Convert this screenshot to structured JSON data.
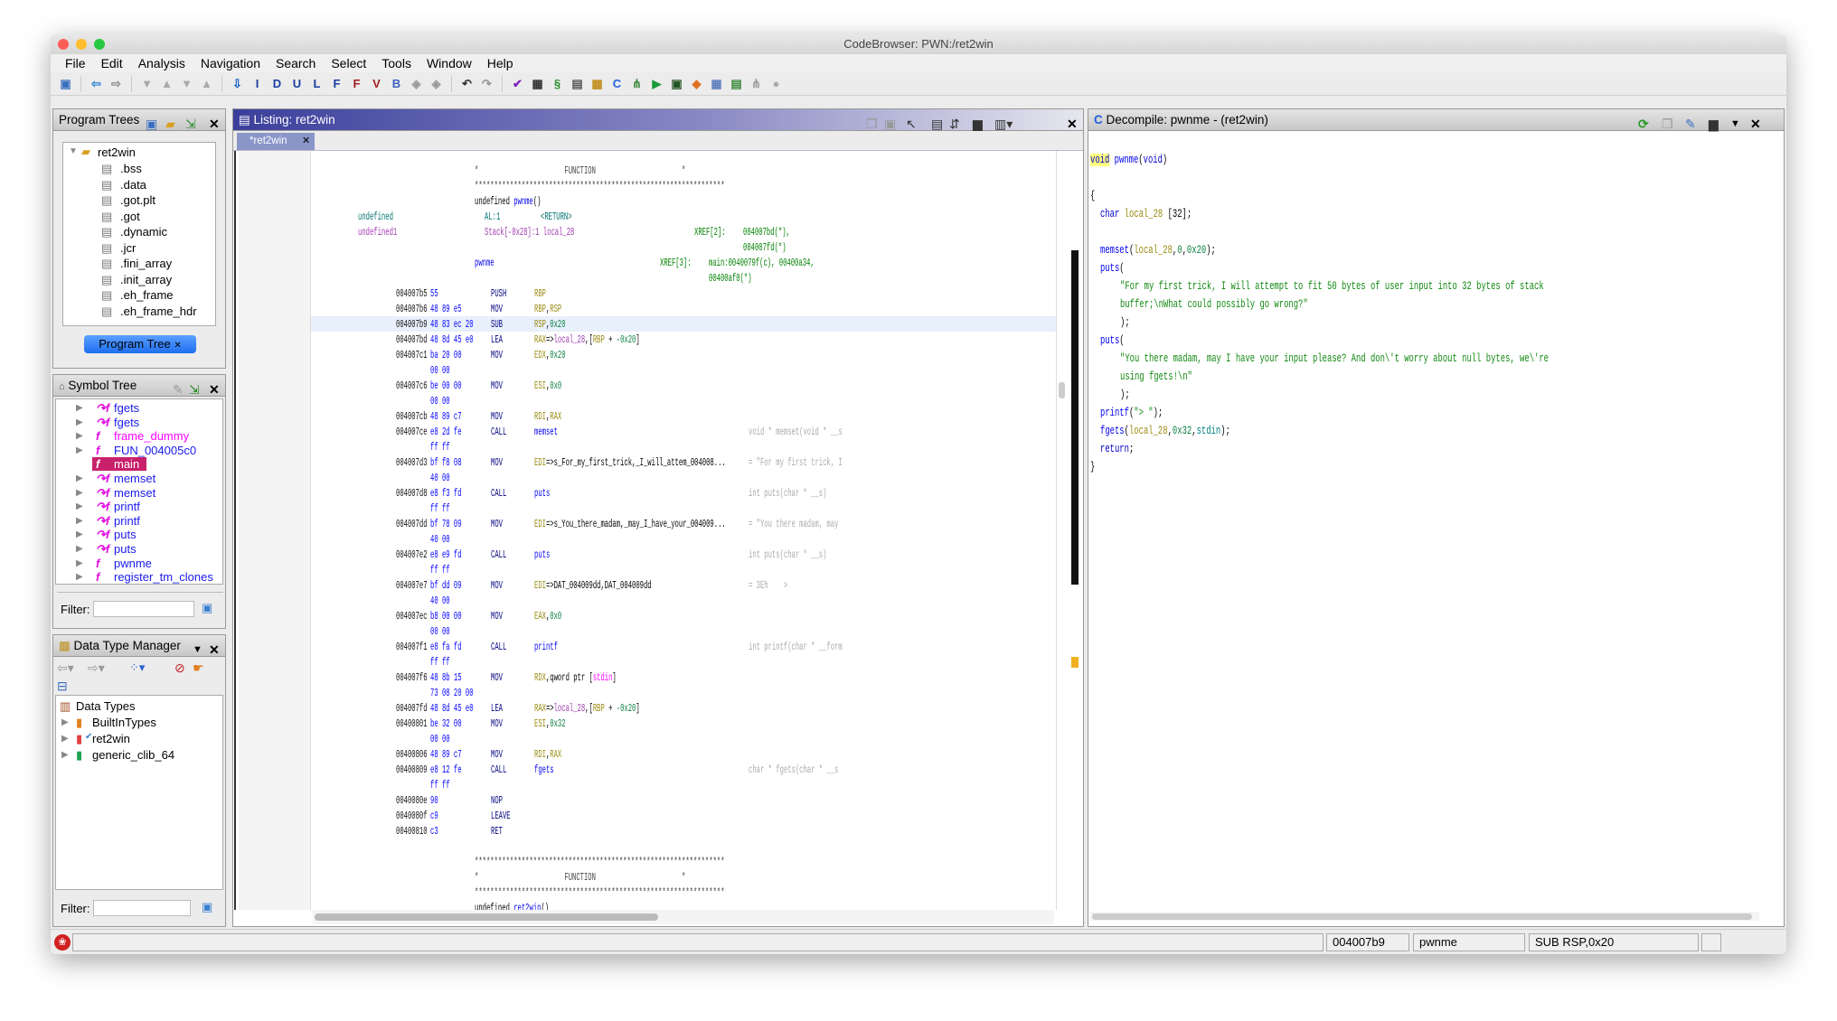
{
  "window": {
    "title": "CodeBrowser: PWN:/ret2win"
  },
  "menu": [
    "File",
    "Edit",
    "Analysis",
    "Navigation",
    "Search",
    "Select",
    "Tools",
    "Window",
    "Help"
  ],
  "toolbar": [
    {
      "icon": "save-icon",
      "g": "▣",
      "c": "#3a6fc0"
    },
    {
      "icon": "back-icon",
      "g": "⇦",
      "c": "#2a7fd0"
    },
    {
      "icon": "forward-icon",
      "g": "⇨",
      "c": "#888"
    },
    {
      "icon": "nav-1-icon",
      "g": "▼",
      "c": "#aaa"
    },
    {
      "icon": "nav-2-icon",
      "g": "▲",
      "c": "#aaa"
    },
    {
      "icon": "nav-3-icon",
      "g": "▼",
      "c": "#aaa"
    },
    {
      "icon": "nav-4-icon",
      "g": "▲",
      "c": "#aaa"
    },
    {
      "icon": "down-arrow-icon",
      "g": "⇩",
      "c": "#1a5fc0"
    },
    {
      "icon": "instruction-icon",
      "g": "I",
      "c": "#1a3fa0"
    },
    {
      "icon": "data-icon",
      "g": "D",
      "c": "#1a3fa0"
    },
    {
      "icon": "undefined-icon",
      "g": "U",
      "c": "#1a3fa0"
    },
    {
      "icon": "label-icon",
      "g": "L",
      "c": "#1a3fa0"
    },
    {
      "icon": "function-icon",
      "g": "F",
      "c": "#1a3fa0"
    },
    {
      "icon": "no-function-icon",
      "g": "F",
      "c": "#a02020"
    },
    {
      "icon": "variable-icon",
      "g": "V",
      "c": "#a02020"
    },
    {
      "icon": "bookmark-icon",
      "g": "B",
      "c": "#4060c0"
    },
    {
      "icon": "merge-1-icon",
      "g": "◈",
      "c": "#999"
    },
    {
      "icon": "merge-2-icon",
      "g": "◈",
      "c": "#999"
    },
    {
      "icon": "undo-icon",
      "g": "↶",
      "c": "#333"
    },
    {
      "icon": "redo-icon",
      "g": "↷",
      "c": "#999"
    },
    {
      "icon": "check-icon",
      "g": "✔",
      "c": "#8020c0"
    },
    {
      "icon": "bytes-icon",
      "g": "▦",
      "c": "#333"
    },
    {
      "icon": "script-icon",
      "g": "§",
      "c": "#2a8a2a"
    },
    {
      "icon": "memory-icon",
      "g": "▤",
      "c": "#555"
    },
    {
      "icon": "datatype-icon",
      "g": "▩",
      "c": "#c09020"
    },
    {
      "icon": "decompile-icon",
      "g": "C",
      "c": "#2060e0"
    },
    {
      "icon": "graph-icon",
      "g": "⋔",
      "c": "#3a8a3a"
    },
    {
      "icon": "run-icon",
      "g": "▶",
      "c": "#1a9a3a"
    },
    {
      "icon": "chip-icon",
      "g": "▣",
      "c": "#225522"
    },
    {
      "icon": "diamond-icon",
      "g": "◆",
      "c": "#e07020"
    },
    {
      "icon": "table-icon",
      "g": "▦",
      "c": "#6080c0"
    },
    {
      "icon": "export-icon",
      "g": "▤",
      "c": "#3a8a3a"
    },
    {
      "icon": "tree-icon",
      "g": "⋔",
      "c": "#999"
    },
    {
      "icon": "help-icon",
      "g": "●",
      "c": "#aaa"
    }
  ],
  "program_trees": {
    "title": "Program Trees",
    "root": "ret2win",
    "items": [
      ".bss",
      ".data",
      ".got.plt",
      ".got",
      ".dynamic",
      ".jcr",
      ".fini_array",
      ".init_array",
      ".eh_frame",
      ".eh_frame_hdr"
    ],
    "tab": "Program Tree"
  },
  "symbol_tree": {
    "title": "Symbol Tree",
    "items": [
      {
        "label": "fgets",
        "color": "#1a1aee",
        "thunk": true
      },
      {
        "label": "fgets",
        "color": "#1a1aee",
        "thunk": true
      },
      {
        "label": "frame_dummy",
        "color": "#ff00ff",
        "thunk": false
      },
      {
        "label": "FUN_004005c0",
        "color": "#1a1aee",
        "thunk": false
      },
      {
        "label": "main",
        "color": "#ffffff",
        "thunk": false,
        "selected": true
      },
      {
        "label": "memset",
        "color": "#1a1aee",
        "thunk": true
      },
      {
        "label": "memset",
        "color": "#1a1aee",
        "thunk": true
      },
      {
        "label": "printf",
        "color": "#1a1aee",
        "thunk": true
      },
      {
        "label": "printf",
        "color": "#1a1aee",
        "thunk": true
      },
      {
        "label": "puts",
        "color": "#1a1aee",
        "thunk": true
      },
      {
        "label": "puts",
        "color": "#1a1aee",
        "thunk": true
      },
      {
        "label": "pwnme",
        "color": "#1a1aee",
        "thunk": false
      },
      {
        "label": "register_tm_clones",
        "color": "#1a1aee",
        "thunk": false
      }
    ],
    "filter_label": "Filter:"
  },
  "data_type_manager": {
    "title": "Data Type Manager",
    "root": "Data Types",
    "items": [
      {
        "label": "BuiltInTypes",
        "color": "#e08020"
      },
      {
        "label": "ret2win",
        "color": "#e04040"
      },
      {
        "label": "generic_clib_64",
        "color": "#20a050"
      }
    ],
    "filter_label": "Filter:"
  },
  "listing": {
    "title": "Listing:  ret2win",
    "tab": "*ret2win",
    "lines": [
      {
        "h": "*                      FUNCTION                      *"
      },
      {
        "h": "****************************************************************"
      },
      {
        "sig": [
          "undefined ",
          "pwnme",
          "()"
        ]
      },
      {
        "p1": [
          "undefined",
          "AL:1",
          "<RETURN>"
        ],
        "pc": "#007070"
      },
      {
        "p1": [
          "undefined1",
          "Stack[-0x28]:1 local_28",
          ""
        ],
        "pc": "#a03cb0",
        "xref": "XREF[2]:",
        "xv": "004007bd(*),"
      },
      {
        "xv": "004007fd(*)"
      },
      {
        "label": "pwnme",
        "xref3": "XREF[3]:",
        "xv3": "main:0040079f(c), 00400a34,"
      },
      {
        "xv3": "00400af0(*)"
      },
      {
        "a": "004007b5",
        "b": "55",
        "m": "PUSH",
        "o": [
          [
            "reg",
            "RBP"
          ]
        ]
      },
      {
        "a": "004007b6",
        "b": "48 89 e5",
        "m": "MOV",
        "o": [
          [
            "reg",
            "RBP"
          ],
          [
            "txt",
            ","
          ],
          [
            "reg",
            "RSP"
          ]
        ]
      },
      {
        "a": "004007b9",
        "b": "48 83 ec 20",
        "m": "SUB",
        "o": [
          [
            "reg",
            "RSP"
          ],
          [
            "txt",
            ","
          ],
          [
            "num",
            "0x20"
          ]
        ],
        "sel": true
      },
      {
        "a": "004007bd",
        "b": "48 8d 45 e0",
        "m": "LEA",
        "o": [
          [
            "reg",
            "RAX"
          ],
          [
            "txt",
            "=>"
          ],
          [
            "var",
            "local_28"
          ],
          [
            "txt",
            ",["
          ],
          [
            "reg",
            "RBP"
          ],
          [
            "txt",
            " + "
          ],
          [
            "num",
            "-0x20"
          ],
          [
            "txt",
            "]"
          ]
        ]
      },
      {
        "a": "004007c1",
        "b": "ba 20 00",
        "m": "MOV",
        "o": [
          [
            "reg",
            "EDX"
          ],
          [
            "txt",
            ","
          ],
          [
            "num",
            "0x20"
          ]
        ]
      },
      {
        "b": "00 00"
      },
      {
        "a": "004007c6",
        "b": "be 00 00",
        "m": "MOV",
        "o": [
          [
            "reg",
            "ESI"
          ],
          [
            "txt",
            ","
          ],
          [
            "num",
            "0x0"
          ]
        ]
      },
      {
        "b": "00 00"
      },
      {
        "a": "004007cb",
        "b": "48 89 c7",
        "m": "MOV",
        "o": [
          [
            "reg",
            "RDI"
          ],
          [
            "txt",
            ","
          ],
          [
            "reg",
            "RAX"
          ]
        ]
      },
      {
        "a": "004007ce",
        "b": "e8 2d fe",
        "m": "CALL",
        "o": [
          [
            "fn",
            "memset"
          ]
        ],
        "c": "void * memset(void * __s"
      },
      {
        "b": "ff ff"
      },
      {
        "a": "004007d3",
        "b": "bf f8 08",
        "m": "MOV",
        "o": [
          [
            "reg",
            "EDI"
          ],
          [
            "txt",
            "=>s_For_my_first_trick,_I_will_attem_004008..."
          ]
        ],
        "c": "= \"For my first trick, I"
      },
      {
        "b": "40 00"
      },
      {
        "a": "004007d8",
        "b": "e8 f3 fd",
        "m": "CALL",
        "o": [
          [
            "fn",
            "puts"
          ]
        ],
        "c": "int puts(char * __s)"
      },
      {
        "b": "ff ff"
      },
      {
        "a": "004007dd",
        "b": "bf 78 09",
        "m": "MOV",
        "o": [
          [
            "reg",
            "EDI"
          ],
          [
            "txt",
            "=>s_You_there_madam,_may_I_have_your_004009..."
          ]
        ],
        "c": "= \"You there madam, may"
      },
      {
        "b": "40 00"
      },
      {
        "a": "004007e2",
        "b": "e8 e9 fd",
        "m": "CALL",
        "o": [
          [
            "fn",
            "puts"
          ]
        ],
        "c": "int puts(char * __s)"
      },
      {
        "b": "ff ff"
      },
      {
        "a": "004007e7",
        "b": "bf dd 09",
        "m": "MOV",
        "o": [
          [
            "reg",
            "EDI"
          ],
          [
            "txt",
            "=>DAT_004009dd,DAT_004009dd"
          ]
        ],
        "c": "= 3Eh    >"
      },
      {
        "b": "40 00"
      },
      {
        "a": "004007ec",
        "b": "b8 00 00",
        "m": "MOV",
        "o": [
          [
            "reg",
            "EAX"
          ],
          [
            "txt",
            ","
          ],
          [
            "num",
            "0x0"
          ]
        ]
      },
      {
        "b": "00 00"
      },
      {
        "a": "004007f1",
        "b": "e8 fa fd",
        "m": "CALL",
        "o": [
          [
            "fn",
            "printf"
          ]
        ],
        "c": "int printf(char * __form"
      },
      {
        "b": "ff ff"
      },
      {
        "a": "004007f6",
        "b": "48 8b 15",
        "m": "MOV",
        "o": [
          [
            "reg",
            "RDX"
          ],
          [
            "txt",
            ",qword ptr ["
          ],
          [
            "mag",
            "stdin"
          ],
          [
            "txt",
            "]"
          ]
        ]
      },
      {
        "b": "73 08 20 00"
      },
      {
        "a": "004007fd",
        "b": "48 8d 45 e0",
        "m": "LEA",
        "o": [
          [
            "reg",
            "RAX"
          ],
          [
            "txt",
            "=>"
          ],
          [
            "var",
            "local_28"
          ],
          [
            "txt",
            ",["
          ],
          [
            "reg",
            "RBP"
          ],
          [
            "txt",
            " + "
          ],
          [
            "num",
            "-0x20"
          ],
          [
            "txt",
            "]"
          ]
        ]
      },
      {
        "a": "00400801",
        "b": "be 32 00",
        "m": "MOV",
        "o": [
          [
            "reg",
            "ESI"
          ],
          [
            "txt",
            ","
          ],
          [
            "num",
            "0x32"
          ]
        ]
      },
      {
        "b": "00 00"
      },
      {
        "a": "00400806",
        "b": "48 89 c7",
        "m": "MOV",
        "o": [
          [
            "reg",
            "RDI"
          ],
          [
            "txt",
            ","
          ],
          [
            "reg",
            "RAX"
          ]
        ]
      },
      {
        "a": "00400809",
        "b": "e8 12 fe",
        "m": "CALL",
        "o": [
          [
            "fn",
            "fgets"
          ]
        ],
        "c": "char * fgets(char * __s"
      },
      {
        "b": "ff ff"
      },
      {
        "a": "0040080e",
        "b": "90",
        "m": "NOP"
      },
      {
        "a": "0040080f",
        "b": "c9",
        "m": "LEAVE"
      },
      {
        "a": "00400810",
        "b": "c3",
        "m": "RET"
      },
      {},
      {
        "h": "****************************************************************"
      },
      {
        "h": "*                      FUNCTION                      *"
      },
      {
        "h": "****************************************************************"
      },
      {
        "sig": [
          "undefined ",
          "ret2win",
          "()"
        ]
      }
    ]
  },
  "decompile": {
    "title": "Decompile: pwnme -  (ret2win)",
    "lines": [
      {
        "i": 0,
        "t": [
          [
            "kw",
            "void"
          ],
          [
            "txt",
            " "
          ],
          [
            "fn",
            "pwnme"
          ],
          [
            "txt",
            "("
          ],
          [
            "kw",
            "void"
          ],
          [
            "txt",
            ")"
          ]
        ]
      },
      {
        "t": []
      },
      {
        "i": 0,
        "t": [
          [
            "txt",
            "{"
          ]
        ]
      },
      {
        "i": 1,
        "t": [
          [
            "kw",
            "char"
          ],
          [
            "txt",
            " "
          ],
          [
            "dv",
            "local_28"
          ],
          [
            "txt",
            " [32];"
          ]
        ]
      },
      {
        "t": []
      },
      {
        "i": 1,
        "t": [
          [
            "fn",
            "memset"
          ],
          [
            "txt",
            "("
          ],
          [
            "dv",
            "local_28"
          ],
          [
            "txt",
            ","
          ],
          [
            "num",
            "0"
          ],
          [
            "txt",
            ","
          ],
          [
            "num",
            "0x20"
          ],
          [
            "txt",
            ");"
          ]
        ]
      },
      {
        "i": 1,
        "t": [
          [
            "fn",
            "puts"
          ],
          [
            "txt",
            "("
          ]
        ]
      },
      {
        "i": 2,
        "t": [
          [
            "str",
            "\"For my first trick, I will attempt to fit 50 bytes of user input into 32 bytes of stack"
          ]
        ]
      },
      {
        "i": 2,
        "t": [
          [
            "str",
            "buffer;\\nWhat could possibly go wrong?\""
          ]
        ]
      },
      {
        "i": 2,
        "t": [
          [
            "txt",
            ");"
          ]
        ]
      },
      {
        "i": 1,
        "t": [
          [
            "fn",
            "puts"
          ],
          [
            "txt",
            "("
          ]
        ]
      },
      {
        "i": 2,
        "t": [
          [
            "str",
            "\"You there madam, may I have your input please? And don\\'t worry about null bytes, we\\'re"
          ]
        ]
      },
      {
        "i": 2,
        "t": [
          [
            "str",
            "using fgets!\\n\""
          ]
        ]
      },
      {
        "i": 2,
        "t": [
          [
            "txt",
            ");"
          ]
        ]
      },
      {
        "i": 1,
        "t": [
          [
            "fn",
            "printf"
          ],
          [
            "txt",
            "("
          ],
          [
            "str",
            "\"> \""
          ],
          [
            "txt",
            ");"
          ]
        ]
      },
      {
        "i": 1,
        "t": [
          [
            "fn",
            "fgets"
          ],
          [
            "txt",
            "("
          ],
          [
            "dv",
            "local_28"
          ],
          [
            "txt",
            ","
          ],
          [
            "num",
            "0x32"
          ],
          [
            "txt",
            ","
          ],
          [
            "tl",
            "stdin"
          ],
          [
            "txt",
            ");"
          ]
        ]
      },
      {
        "i": 1,
        "t": [
          [
            "kw",
            "return"
          ],
          [
            "txt",
            ";"
          ]
        ]
      },
      {
        "i": 0,
        "t": [
          [
            "txt",
            "}"
          ]
        ]
      }
    ]
  },
  "status": {
    "address": "004007b9",
    "function": "pwnme",
    "instruction": "SUB RSP,0x20"
  },
  "colors": {
    "listing_header": "#3b3f9b",
    "selection": "#e8f0fb",
    "symbol_selected": "#c8206a",
    "program_tree_tab": "#2f7cf0"
  }
}
